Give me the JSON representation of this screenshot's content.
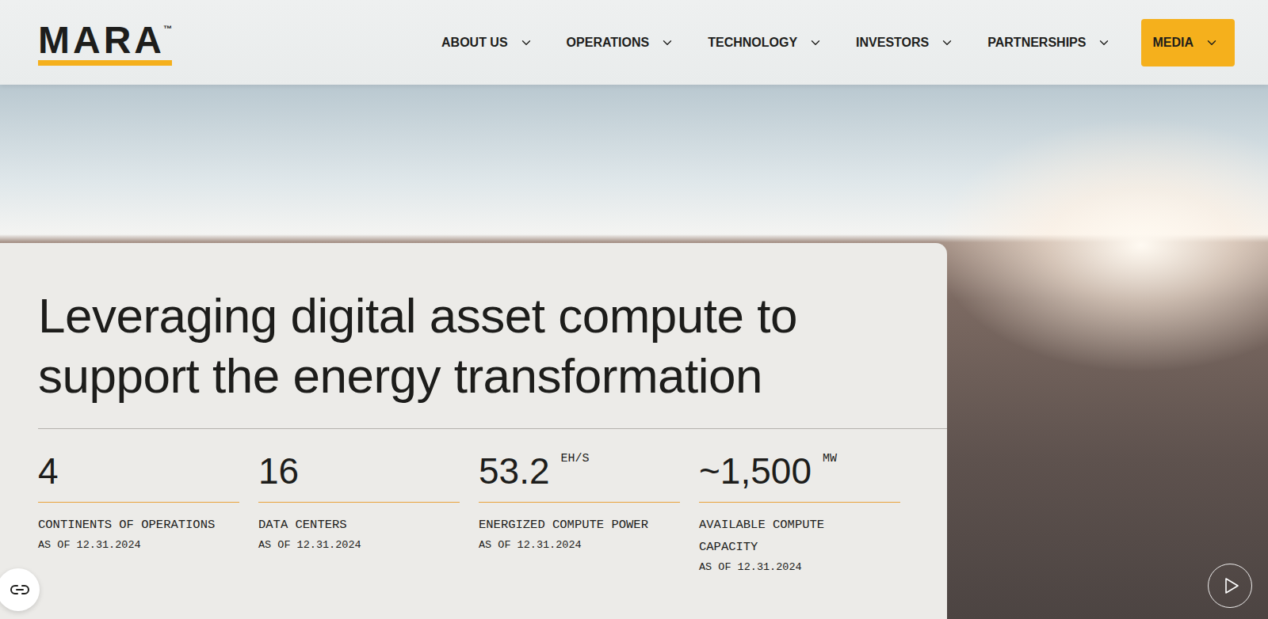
{
  "header": {
    "logo": {
      "text": "MARA",
      "mark": "™"
    },
    "nav": [
      {
        "label": "ABOUT US",
        "selected": false
      },
      {
        "label": "OPERATIONS",
        "selected": false
      },
      {
        "label": "TECHNOLOGY",
        "selected": false
      },
      {
        "label": "INVESTORS",
        "selected": false
      },
      {
        "label": "PARTNERSHIPS",
        "selected": false
      },
      {
        "label": "MEDIA",
        "selected": true
      }
    ]
  },
  "hero": {
    "headline": [
      "Leveraging digital asset compute to",
      "support the energy transformation"
    ],
    "stats": [
      {
        "value": "4",
        "label": "CONTINENTS OF OPERATIONS",
        "date": "AS OF 12.31.2024"
      },
      {
        "value": "16",
        "label": "DATA CENTERS",
        "date": "AS OF 12.31.2024"
      },
      {
        "value": "53.2",
        "unit": "EH/S",
        "label": "ENERGIZED COMPUTE POWER",
        "date": "AS OF 12.31.2024"
      },
      {
        "value": "~1,500",
        "unit": "MW",
        "label": "AVAILABLE COMPUTE CAPACITY",
        "date": "AS OF 12.31.2024"
      }
    ]
  }
}
